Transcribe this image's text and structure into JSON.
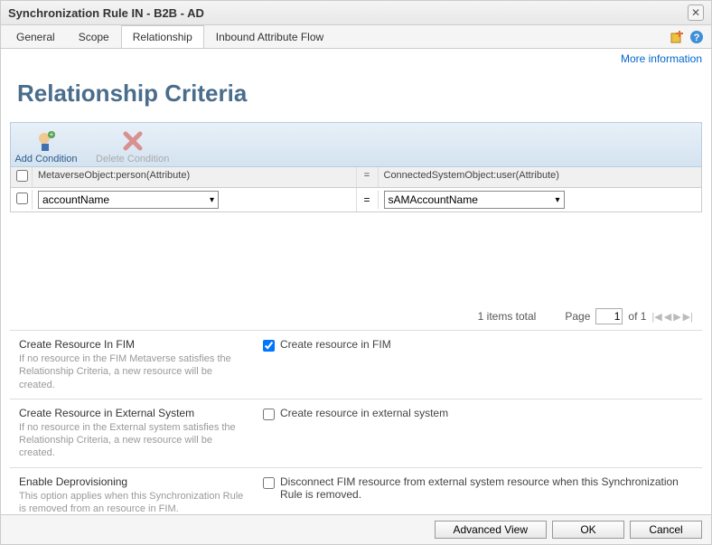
{
  "window": {
    "title": "Synchronization Rule IN - B2B - AD"
  },
  "tabs": {
    "general": "General",
    "scope": "Scope",
    "relationship": "Relationship",
    "inbound": "Inbound Attribute Flow"
  },
  "more_info": "More information",
  "section_heading": "Relationship Criteria",
  "toolbar": {
    "add": "Add Condition",
    "delete": "Delete Condition"
  },
  "grid": {
    "header_left": "MetaverseObject:person(Attribute)",
    "header_eq": "=",
    "header_right": "ConnectedSystemObject:user(Attribute)",
    "row1_left": "accountName",
    "row1_eq": "=",
    "row1_right": "sAMAccountName"
  },
  "pager": {
    "total": "1 items total",
    "page_label": "Page",
    "page_value": "1",
    "of": "of 1"
  },
  "options": {
    "fim_title": "Create Resource In FIM",
    "fim_desc": "If no resource in the FIM Metaverse satisfies the Relationship Criteria, a new resource will be created.",
    "fim_check": "Create resource in FIM",
    "ext_title": "Create Resource in External System",
    "ext_desc": "If no resource in the External system satisfies the Relationship Criteria, a new resource will be created.",
    "ext_check": "Create resource in external system",
    "deprov_title": "Enable Deprovisioning",
    "deprov_desc": "This option applies when this Synchronization Rule is removed from an resource in FIM.",
    "deprov_check": "Disconnect FIM resource from external system resource when this Synchronization Rule is removed."
  },
  "footer": {
    "advanced": "Advanced View",
    "ok": "OK",
    "cancel": "Cancel"
  }
}
